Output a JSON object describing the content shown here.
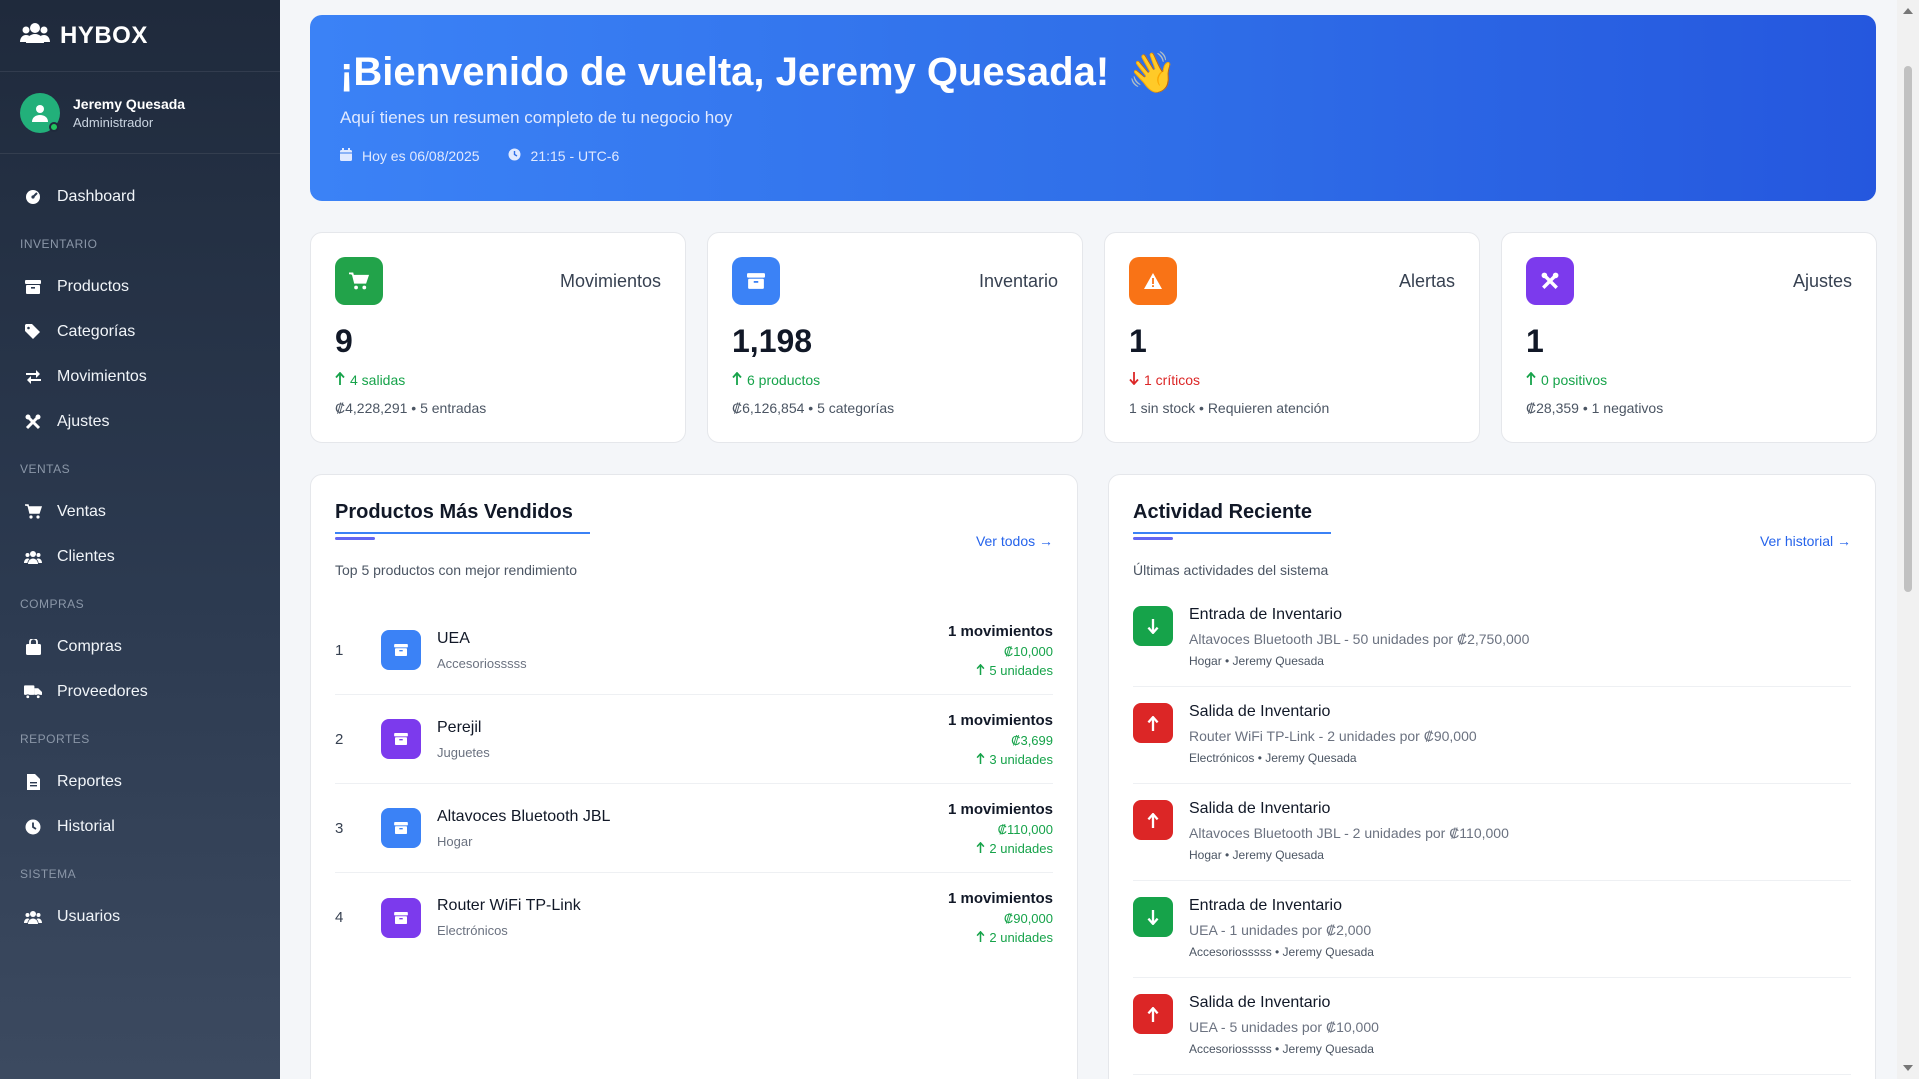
{
  "brand": {
    "name": "HYBOX"
  },
  "user": {
    "name": "Jeremy Quesada",
    "role": "Administrador"
  },
  "nav": {
    "dashboard": "Dashboard",
    "sections": {
      "inventario": "INVENTARIO",
      "ventas": "VENTAS",
      "compras": "COMPRAS",
      "reportes": "REPORTES",
      "sistema": "SISTEMA"
    },
    "productos": "Productos",
    "categorias": "Categorías",
    "movimientos": "Movimientos",
    "ajustes": "Ajustes",
    "ventas": "Ventas",
    "clientes": "Clientes",
    "compras": "Compras",
    "proveedores": "Proveedores",
    "reportes": "Reportes",
    "historial": "Historial",
    "usuarios": "Usuarios"
  },
  "hero": {
    "title": "¡Bienvenido de vuelta, Jeremy Quesada!",
    "emoji": "👋",
    "subtitle": "Aquí tienes un resumen completo de tu negocio hoy",
    "date": "Hoy es 06/08/2025",
    "time": "21:15 - UTC-6"
  },
  "cards": [
    {
      "title": "Movimientos",
      "value": "9",
      "trend": "4 salidas",
      "trend_dir": "up",
      "foot": "₡4,228,291 • 5 entradas",
      "color": "#22a34a",
      "icon": "cart-icon"
    },
    {
      "title": "Inventario",
      "value": "1,198",
      "trend": "6 productos",
      "trend_dir": "up",
      "foot": "₡6,126,854 • 5 categorías",
      "color": "#3b82f6",
      "icon": "box-icon"
    },
    {
      "title": "Alertas",
      "value": "1",
      "trend": "1 críticos",
      "trend_dir": "down",
      "foot": "1 sin stock • Requieren atención",
      "color": "#f97316",
      "icon": "warning-icon"
    },
    {
      "title": "Ajustes",
      "value": "1",
      "trend": "0 positivos",
      "trend_dir": "up",
      "foot": "₡28,359 • 1 negativos",
      "color": "#7c3aed",
      "icon": "tools-icon"
    }
  ],
  "top_products": {
    "title": "Productos Más Vendidos",
    "link": "Ver todos →",
    "desc": "Top 5 productos con mejor rendimiento",
    "items": [
      {
        "rank": "1",
        "name": "UEA",
        "category": "Accesoriosssss",
        "movements": "1 movimientos",
        "amount": "₡10,000",
        "units": "5 unidades",
        "color": "#3b82f6"
      },
      {
        "rank": "2",
        "name": "Perejil",
        "category": "Juguetes",
        "movements": "1 movimientos",
        "amount": "₡3,699",
        "units": "3 unidades",
        "color": "#7c3aed"
      },
      {
        "rank": "3",
        "name": "Altavoces Bluetooth JBL",
        "category": "Hogar",
        "movements": "1 movimientos",
        "amount": "₡110,000",
        "units": "2 unidades",
        "color": "#3b82f6"
      },
      {
        "rank": "4",
        "name": "Router WiFi TP-Link",
        "category": "Electrónicos",
        "movements": "1 movimientos",
        "amount": "₡90,000",
        "units": "2 unidades",
        "color": "#7c3aed"
      }
    ]
  },
  "recent_activity": {
    "title": "Actividad Reciente",
    "link": "Ver historial →",
    "desc": "Últimas actividades del sistema",
    "items": [
      {
        "type": "in",
        "title": "Entrada de Inventario",
        "desc": "Altavoces Bluetooth JBL - 50 unidades por ₡2,750,000",
        "meta": "Hogar • Jeremy Quesada",
        "color": "#16a34a"
      },
      {
        "type": "out",
        "title": "Salida de Inventario",
        "desc": "Router WiFi TP-Link - 2 unidades por ₡90,000",
        "meta": "Electrónicos • Jeremy Quesada",
        "color": "#dc2626"
      },
      {
        "type": "out",
        "title": "Salida de Inventario",
        "desc": "Altavoces Bluetooth JBL - 2 unidades por ₡110,000",
        "meta": "Hogar • Jeremy Quesada",
        "color": "#dc2626"
      },
      {
        "type": "in",
        "title": "Entrada de Inventario",
        "desc": "UEA - 1 unidades por ₡2,000",
        "meta": "Accesoriosssss • Jeremy Quesada",
        "color": "#16a34a"
      },
      {
        "type": "out",
        "title": "Salida de Inventario",
        "desc": "UEA - 5 unidades por ₡10,000",
        "meta": "Accesoriosssss • Jeremy Quesada",
        "color": "#dc2626"
      }
    ]
  }
}
